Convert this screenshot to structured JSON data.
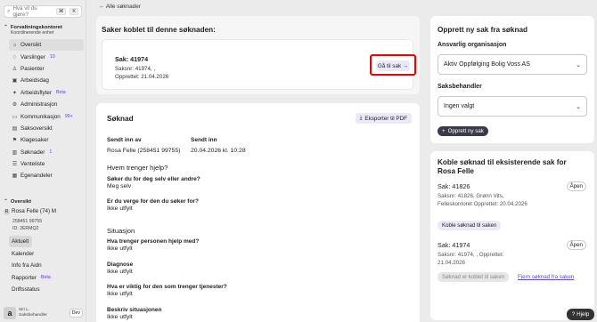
{
  "sidebar": {
    "search_placeholder": "Hva vil du gjøre?",
    "kbd_cmd": "⌘",
    "kbd_k": "K",
    "org_title": "Forvaltningskontoret",
    "org_sub": "Koordinerende enhet",
    "items": [
      {
        "label": "Oversikt",
        "icon": "home-icon",
        "glyph": "⌂",
        "active": true
      },
      {
        "label": "Varslinger",
        "icon": "bell-icon",
        "glyph": "♢",
        "badge": "10"
      },
      {
        "label": "Pasienter",
        "icon": "person-icon",
        "glyph": "♙"
      },
      {
        "label": "Arbeidsdag",
        "icon": "briefcase-icon",
        "glyph": "▣"
      },
      {
        "label": "Arbeidsflyter",
        "icon": "sparkle-icon",
        "glyph": "✦",
        "badge": "Beta"
      },
      {
        "label": "Administrasjon",
        "icon": "gear-icon",
        "glyph": "⚙"
      },
      {
        "label": "Kommunikasjon",
        "icon": "chat-icon",
        "glyph": "▭",
        "badge": "99+"
      },
      {
        "label": "Saksoversikt",
        "icon": "folder-icon",
        "glyph": "▤"
      },
      {
        "label": "Klagesaker",
        "icon": "flag-icon",
        "glyph": "⚑"
      },
      {
        "label": "Søknader",
        "icon": "inbox-icon",
        "glyph": "▥",
        "badge": "1"
      },
      {
        "label": "Venteliste",
        "icon": "list-icon",
        "glyph": "☰"
      },
      {
        "label": "Egenandeler",
        "icon": "receipt-icon",
        "glyph": "▦"
      }
    ],
    "person_section": "Oversikt",
    "person_name": "Rosa Felle (74) M",
    "person_initial": "R",
    "person_phone": "258451 99755",
    "person_id": "ID: 2ERMQ2",
    "person_links": [
      {
        "label": "Aktuelt",
        "active": true
      },
      {
        "label": "Kalender"
      },
      {
        "label": "Info fra Aidn"
      },
      {
        "label": "Rapporter",
        "badge": "Beta"
      },
      {
        "label": "Driftsstatus"
      }
    ],
    "user_logo": "a",
    "user_name": "Siri L.",
    "user_role": "Saksbehandler",
    "env": "Dev"
  },
  "main": {
    "back_link": "Alle søknader",
    "linked_title": "Saker koblet til denne søknaden:",
    "case_title": "Sak: 41974",
    "case_saksnr": "Saksnr: 41974, ,",
    "case_created": "Opprettet: 21.04.2026",
    "goto_label": "Gå til sak",
    "form_title": "Søknad",
    "export_label": "Eksporter til PDF",
    "sent_by_label": "Sendt inn av",
    "sent_by_value": "Rosa Felle (258451 99755)",
    "sent_label": "Sendt inn",
    "sent_value": "20.04.2026 kl. 10:28",
    "sec_help": "Hvem trenger hjelp?",
    "q1": "Søker du for deg selv eller andre?",
    "a1": "Meg selv",
    "q2": "Er du verge for den du søker for?",
    "a2": "Ikke utfylt",
    "sec_situation": "Situasjon",
    "q3": "Hva trenger personen hjelp med?",
    "a3": "Ikke utfylt",
    "q4": "Diagnose",
    "a4": "Ikke utfylt",
    "q5": "Hva er viktig for den som trenger tjenester?",
    "a5": "Ikke utfylt",
    "q6": "Beskriv situasjonen",
    "a6": "Ikke utfylt"
  },
  "right": {
    "new_title": "Opprett ny sak fra søknad",
    "org_label": "Ansvarlig organisasjon",
    "org_value": "Aktiv Oppfølging Bolig Voss AS",
    "handler_label": "Saksbehandler",
    "handler_value": "Ingen valgt",
    "create_label": "Opprett ny sak",
    "link_title": "Koble søknad til eksisterende sak for Rosa Felle",
    "c1_title": "Sak: 41826",
    "c1_status": "Åpen",
    "c1_meta": "Saksnr: 41826, Grønn Vits, Felleskontoret Opprettet: 20.04.2026",
    "c1_btn": "Koble søknad til saken",
    "c2_title": "Sak: 41974",
    "c2_status": "Åpen",
    "c2_meta": "Saksnr: 41974, , Opprettet: 21.04.2026",
    "c2_btn": "Søknad er koblet til saken",
    "c2_link": "Fjern søknad fra saken"
  },
  "help_label": "Hjelp",
  "colors": {
    "accent": "#5c4bb8",
    "highlight": "#e00000",
    "primary": "#3a3a4b"
  }
}
